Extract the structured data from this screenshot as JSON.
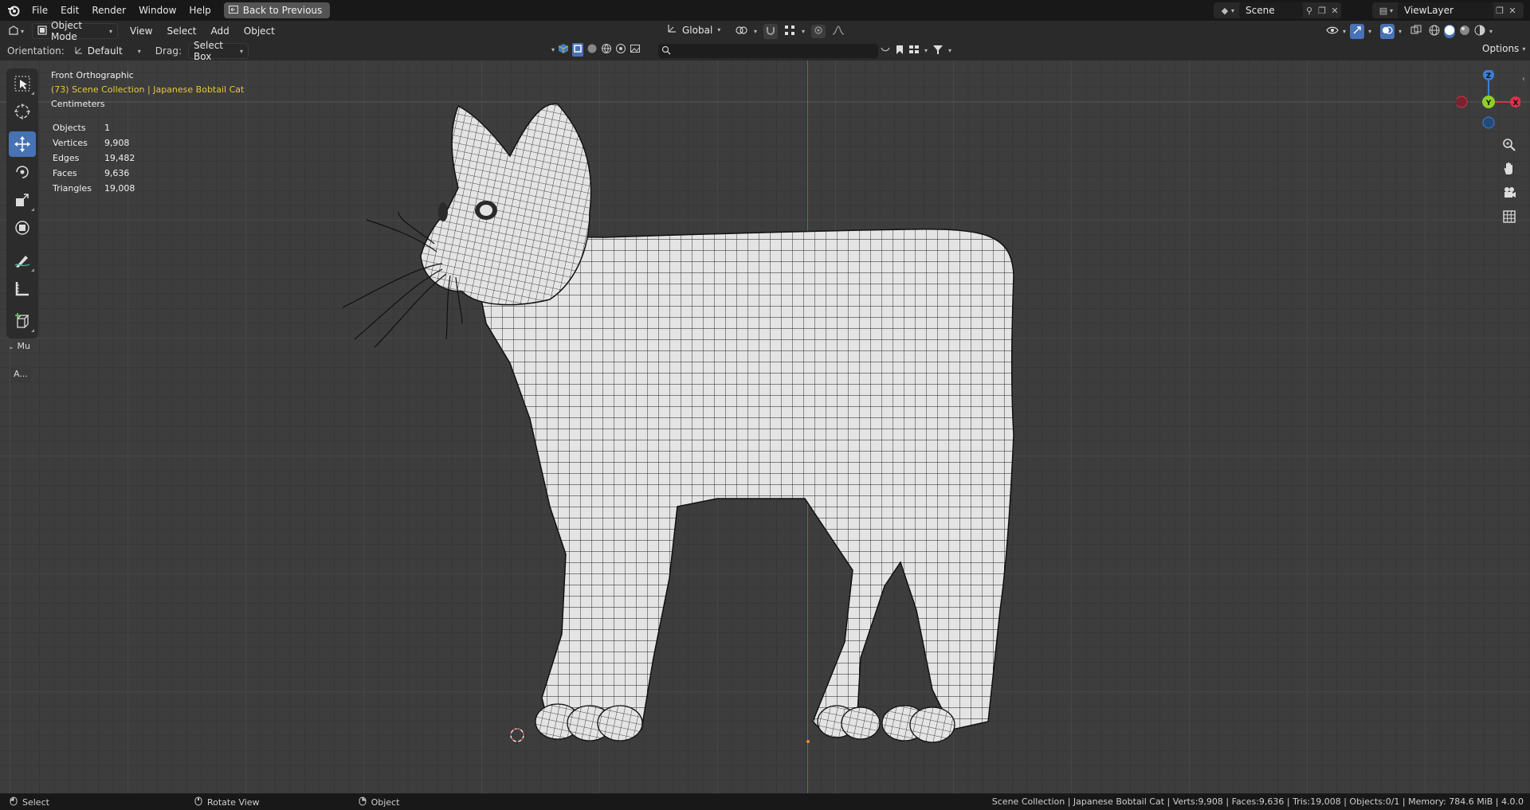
{
  "menubar": {
    "items": [
      "File",
      "Edit",
      "Render",
      "Window",
      "Help"
    ],
    "back_button": "Back to Previous",
    "scene": "Scene",
    "view_layer": "ViewLayer"
  },
  "header": {
    "mode": "Object Mode",
    "menus": [
      "View",
      "Select",
      "Add",
      "Object"
    ],
    "transform_orientation": "Global"
  },
  "tool_settings": {
    "orientation_label": "Orientation:",
    "orientation_value": "Default",
    "drag_label": "Drag:",
    "drag_value": "Select Box",
    "search_placeholder": "",
    "options_label": "Options"
  },
  "viewport": {
    "view_name": "Front Orthographic",
    "collection": "(73) Scene Collection | Japanese Bobtail Cat",
    "units": "Centimeters",
    "gizmo_labels": {
      "z": "Z",
      "y": "Y",
      "x": "X"
    }
  },
  "stats": [
    {
      "label": "Objects",
      "value": "1"
    },
    {
      "label": "Vertices",
      "value": "9,908"
    },
    {
      "label": "Edges",
      "value": "19,482"
    },
    {
      "label": "Faces",
      "value": "9,636"
    },
    {
      "label": "Triangles",
      "value": "19,008"
    }
  ],
  "side_panel": {
    "collapsed_label": "Mu",
    "button_label": "A..."
  },
  "statusbar": {
    "select": "Select",
    "rotate_view": "Rotate View",
    "object": "Object",
    "summary": "Scene Collection | Japanese Bobtail Cat | Verts:9,908 | Faces:9,636 | Tris:19,008 | Objects:0/1 | Memory: 784.6 MiB | 4.0.0"
  },
  "colors": {
    "accent": "#4772b3",
    "highlight_text": "#e8c640",
    "z_axis": "#2f6fc2"
  }
}
